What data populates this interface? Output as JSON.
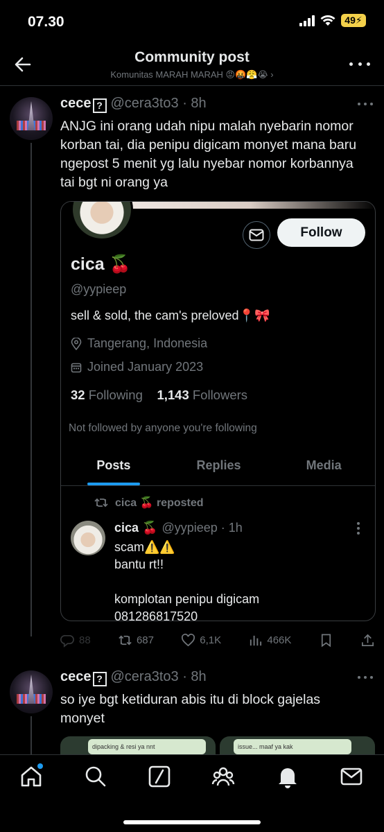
{
  "status": {
    "time": "07.30",
    "battery": "49"
  },
  "header": {
    "title": "Community post",
    "subtitle": "Komunitas MARAH MARAH 😡🤬😤😭 ›"
  },
  "post1": {
    "name": "cece",
    "badge": "?",
    "handle": "@cera3to3 · 8h",
    "text": "ANJG ini orang udah nipu malah nyebarin nomor korban tai, dia penipu digicam monyet mana baru ngepost 5 menit yg lalu nyebar nomor korbannya tai bgt ni orang ya"
  },
  "card": {
    "follow_label": "Follow",
    "name": "cica 🍒",
    "handle": "@yypieep",
    "bio": "sell & sold, the cam's preloved📍🎀",
    "location": "Tangerang, Indonesia",
    "joined": "Joined January 2023",
    "following_count": "32",
    "following_label": "Following",
    "followers_count": "1,143",
    "followers_label": "Followers",
    "note": "Not followed by anyone you're following",
    "tabs": [
      "Posts",
      "Replies",
      "Media"
    ],
    "repost_label": "cica 🍒 reposted",
    "inner_post": {
      "name": "cica 🍒",
      "handle": "@yypieep · 1h",
      "text": "scam⚠️⚠️\nbantu rt!!\n\nkomplotan penipu digicam\n081286817520"
    }
  },
  "actions": {
    "replies": "88",
    "reposts": "687",
    "likes": "6,1K",
    "views": "466K"
  },
  "post2": {
    "name": "cece",
    "badge": "?",
    "handle": "@cera3to3 · 8h",
    "text": "so iye bgt ketiduran abis itu di block gajelas monyet",
    "image1_text": "dipacking & resi ya nnt",
    "image2_text": "issue... maaf ya kak"
  },
  "colors": {
    "accent": "#1d9bf0",
    "muted": "#71767b",
    "background": "#000000"
  }
}
